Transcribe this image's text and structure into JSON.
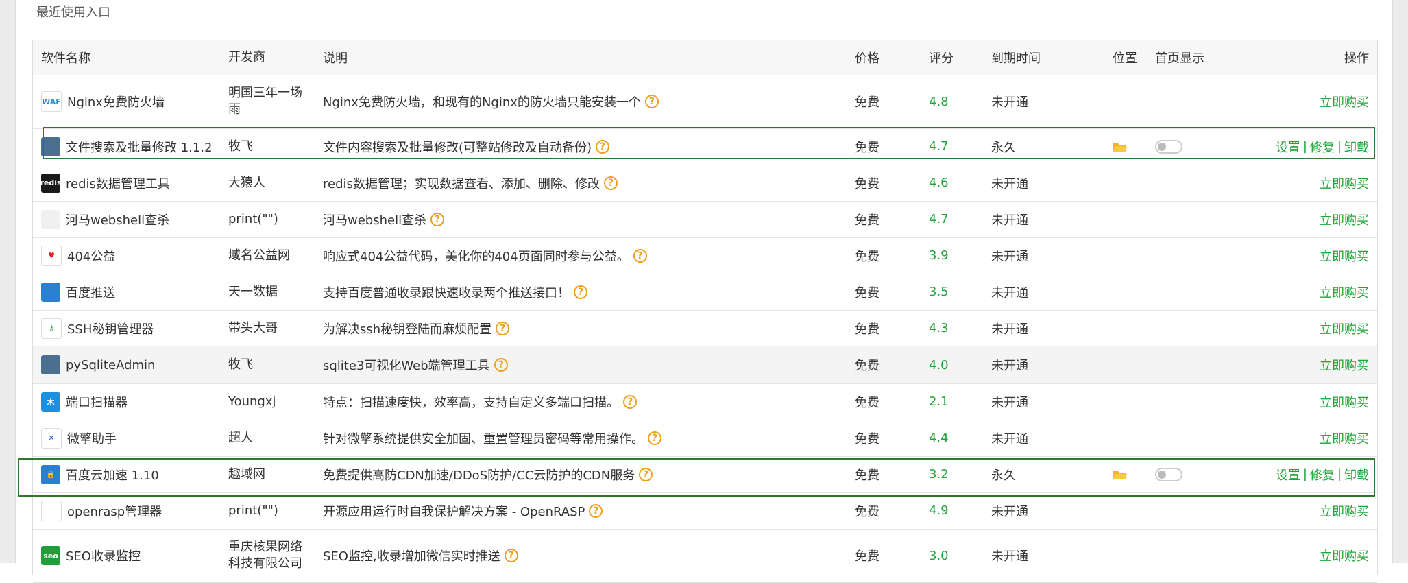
{
  "section_title": "最近使用入口",
  "colors": {
    "accent": "#20a53a",
    "help": "#f0a020",
    "highlight": "#2d7a2d"
  },
  "columns": {
    "name": "软件名称",
    "developer": "开发商",
    "description": "说明",
    "price": "价格",
    "score": "评分",
    "expire": "到期时间",
    "position": "位置",
    "home_display": "首页显示",
    "operations": "操作"
  },
  "actions": {
    "buy": "立即购买",
    "settings": "设置",
    "repair": "修复",
    "uninstall": "卸载",
    "separator": "|",
    "help_glyph": "?"
  },
  "rows": [
    {
      "name": "Nginx免费防火墙",
      "developer": "明国三年一场雨",
      "description": "Nginx免费防火墙，和现有的Nginx的防火墙只能安装一个",
      "price": "免费",
      "score": "4.8",
      "expire": "未开通",
      "icon": "waf-icon",
      "icon_text": "WAF",
      "icon_bg": "#ffffff",
      "icon_fg": "#2d8fc8",
      "installed": false
    },
    {
      "name": "文件搜索及批量修改 1.1.2",
      "developer": "牧飞",
      "description": "文件内容搜索及批量修改(可整站修改及自动备份)",
      "price": "免费",
      "score": "4.7",
      "expire": "永久",
      "icon": "file-search-icon",
      "icon_text": "",
      "icon_bg": "#4a6f8f",
      "icon_fg": "#ffffff",
      "installed": true,
      "home_on": false
    },
    {
      "name": "redis数据管理工具",
      "developer": "大猿人",
      "description": "redis数据管理；实现数据查看、添加、删除、修改",
      "price": "免费",
      "score": "4.6",
      "expire": "未开通",
      "icon": "redis-icon",
      "icon_text": "redis",
      "icon_bg": "#1a1a1a",
      "icon_fg": "#ffffff",
      "installed": false
    },
    {
      "name": "河马webshell查杀",
      "developer": "print(\"\")",
      "description": "河马webshell查杀",
      "price": "免费",
      "score": "4.7",
      "expire": "未开通",
      "icon": "hippo-icon",
      "icon_text": "",
      "icon_bg": "#f0f0f0",
      "icon_fg": "#d86a2a",
      "installed": false
    },
    {
      "name": "404公益",
      "developer": "域名公益网",
      "description": "响应式404公益代码，美化你的404页面同时参与公益。",
      "price": "免费",
      "score": "3.9",
      "expire": "未开通",
      "icon": "heart-icon",
      "icon_text": "♥",
      "icon_bg": "#ffffff",
      "icon_fg": "#e0202a",
      "installed": false
    },
    {
      "name": "百度推送",
      "developer": "天一数据",
      "description": "支持百度普通收录跟快速收录两个推送接口！",
      "price": "免费",
      "score": "3.5",
      "expire": "未开通",
      "icon": "globe-icon",
      "icon_text": "",
      "icon_bg": "#2a7fd0",
      "icon_fg": "#ffffff",
      "installed": false
    },
    {
      "name": "SSH秘钥管理器",
      "developer": "带头大哥",
      "description": "为解决ssh秘钥登陆而麻烦配置",
      "price": "免费",
      "score": "4.3",
      "expire": "未开通",
      "icon": "key-icon",
      "icon_text": "⚷",
      "icon_bg": "#ffffff",
      "icon_fg": "#2e9e5b",
      "installed": false
    },
    {
      "name": "pySqliteAdmin",
      "developer": "牧飞",
      "description": "sqlite3可视化Web端管理工具",
      "price": "免费",
      "score": "4.0",
      "expire": "未开通",
      "icon": "sqlite-icon",
      "icon_text": "",
      "icon_bg": "#4a6f8f",
      "icon_fg": "#ffffff",
      "installed": false
    },
    {
      "name": "端口扫描器",
      "developer": "Youngxj",
      "description": "特点：扫描速度快，效率高，支持自定义多端口扫描。",
      "price": "免费",
      "score": "2.1",
      "expire": "未开通",
      "icon": "port-scan-icon",
      "icon_text": "木",
      "icon_bg": "#1d8fe0",
      "icon_fg": "#ffffff",
      "installed": false
    },
    {
      "name": "微擎助手",
      "developer": "超人",
      "description": "针对微擎系统提供安全加固、重置管理员密码等常用操作。",
      "price": "免费",
      "score": "4.4",
      "expire": "未开通",
      "icon": "tools-icon",
      "icon_text": "✕",
      "icon_bg": "#ffffff",
      "icon_fg": "#1d5fd0",
      "installed": false
    },
    {
      "name": "百度云加速 1.10",
      "developer": "趣域网",
      "description": "免费提供高防CDN加速/DDoS防护/CC云防护的CDN服务",
      "price": "免费",
      "score": "3.2",
      "expire": "永久",
      "icon": "shield-lock-icon",
      "icon_text": "🔒",
      "icon_bg": "#2a7fd0",
      "icon_fg": "#ffcc33",
      "installed": true,
      "home_on": false
    },
    {
      "name": "openrasp管理器",
      "developer": "print(\"\")",
      "description": "开源应用运行时自我保护解决方案 - OpenRASP",
      "price": "免费",
      "score": "4.9",
      "expire": "未开通",
      "icon": "rasp-icon",
      "icon_text": "",
      "icon_bg": "#ffffff",
      "icon_fg": "#222222",
      "installed": false
    },
    {
      "name": "SEO收录监控",
      "developer": "重庆核果网络科技有限公司",
      "description": "SEO监控,收录增加微信实时推送",
      "price": "免费",
      "score": "3.0",
      "expire": "未开通",
      "icon": "seo-icon",
      "icon_text": "seo",
      "icon_bg": "#1f9e3a",
      "icon_fg": "#ffffff",
      "installed": false
    }
  ]
}
